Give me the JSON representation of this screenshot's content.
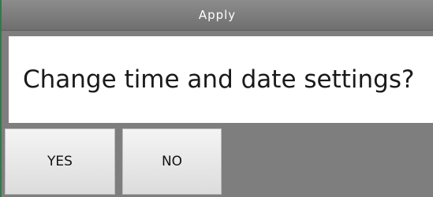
{
  "dialog": {
    "title": "Apply",
    "message": "Change time and date settings?",
    "yes_label": "YES",
    "no_label": "NO"
  },
  "colors": {
    "title_bar": "#7e7e7e",
    "background": "#7e7e7e",
    "panel": "#ffffff",
    "button": "#e8e8e8",
    "left_accent": "#2f7a4a"
  }
}
